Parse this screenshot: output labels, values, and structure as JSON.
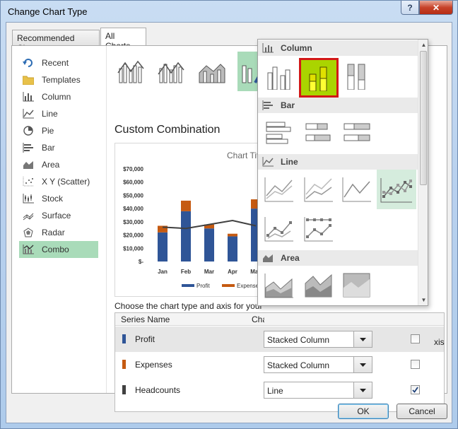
{
  "window": {
    "title": "Change Chart Type"
  },
  "titlebar": {
    "help_label": "?",
    "close_label": "✕"
  },
  "tabs": [
    {
      "label": "Recommended Charts",
      "active": false
    },
    {
      "label": "All Charts",
      "active": true
    }
  ],
  "sidebar": {
    "items": [
      {
        "label": "Recent",
        "icon": "recent-icon"
      },
      {
        "label": "Templates",
        "icon": "folder-icon"
      },
      {
        "label": "Column",
        "icon": "column-chart-icon"
      },
      {
        "label": "Line",
        "icon": "line-chart-icon"
      },
      {
        "label": "Pie",
        "icon": "pie-chart-icon"
      },
      {
        "label": "Bar",
        "icon": "bar-chart-icon"
      },
      {
        "label": "Area",
        "icon": "area-chart-icon"
      },
      {
        "label": "X Y (Scatter)",
        "icon": "scatter-chart-icon"
      },
      {
        "label": "Stock",
        "icon": "stock-chart-icon"
      },
      {
        "label": "Surface",
        "icon": "surface-chart-icon"
      },
      {
        "label": "Radar",
        "icon": "radar-chart-icon"
      },
      {
        "label": "Combo",
        "icon": "combo-chart-icon",
        "active": true
      }
    ]
  },
  "main": {
    "heading": "Custom Combination",
    "choose_label": "Choose the chart type and axis for your data series:",
    "series_header": {
      "name": "Series Name",
      "type": "Chart Type",
      "axis": "Secondary Axis"
    },
    "series": [
      {
        "name": "Profit",
        "color": "#2f5597",
        "type": "Stacked Column",
        "secondary": false
      },
      {
        "name": "Expenses",
        "color": "#c55a11",
        "type": "Stacked Column",
        "secondary": false
      },
      {
        "name": "Headcounts",
        "color": "#404040",
        "type": "Line",
        "secondary": true
      }
    ],
    "axis_header_visible": "xis"
  },
  "dropdown": {
    "sections": [
      {
        "label": "Column",
        "icon": "column-chart-icon"
      },
      {
        "label": "Bar",
        "icon": "bar-chart-icon"
      },
      {
        "label": "Line",
        "icon": "line-chart-icon"
      },
      {
        "label": "Area",
        "icon": "area-chart-icon"
      }
    ]
  },
  "buttons": {
    "ok": "OK",
    "cancel": "Cancel"
  },
  "chart_data": {
    "type": "bar",
    "title": "Chart Title",
    "title_visible": "Chart Tit",
    "categories": [
      "Jan",
      "Feb",
      "Mar",
      "Apr",
      "May"
    ],
    "series": [
      {
        "name": "Profit",
        "type": "stacked-column",
        "color": "#2f5597",
        "values": [
          22000,
          38000,
          25000,
          19000,
          40000
        ]
      },
      {
        "name": "Expenses",
        "type": "stacked-column",
        "color": "#c55a11",
        "values": [
          5000,
          8000,
          3000,
          2000,
          7000
        ]
      },
      {
        "name": "Headcounts",
        "type": "line",
        "color": "#404040",
        "values": [
          26000,
          25000,
          28000,
          31000,
          27000
        ]
      }
    ],
    "ylim": [
      0,
      70000
    ],
    "yticks": [
      "$70,000",
      "$60,000",
      "$50,000",
      "$40,000",
      "$30,000",
      "$20,000",
      "$10,000",
      "$-"
    ],
    "legend": {
      "placement": "bottom",
      "entries": [
        "Profit",
        "Expenses"
      ]
    }
  }
}
